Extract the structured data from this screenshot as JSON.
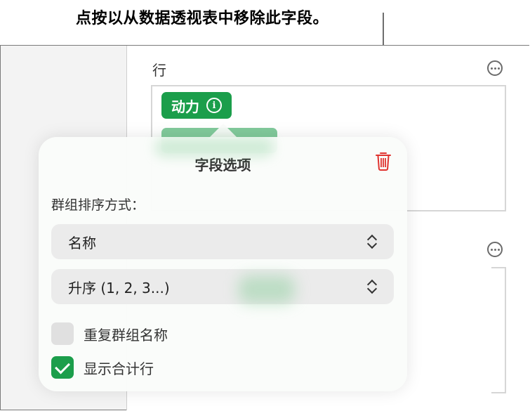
{
  "callout": {
    "text": "点按以从数据透视表中移除此字段。"
  },
  "rows_section": {
    "label": "行",
    "chip_label": "动力"
  },
  "popover": {
    "title": "字段选项",
    "sort_label": "群组排序方式：",
    "sort_by_value": "名称",
    "order_value": "升序 (1, 2, 3...)",
    "repeat_names_label": "重复群组名称",
    "repeat_names_checked": false,
    "show_totals_label": "显示合计行",
    "show_totals_checked": true
  },
  "colors": {
    "accent": "#1b9e4b",
    "delete": "#e0322e"
  },
  "icons": [
    "more-icon",
    "info-icon",
    "trash-icon",
    "chevron-updown-icon",
    "checkmark-icon"
  ]
}
